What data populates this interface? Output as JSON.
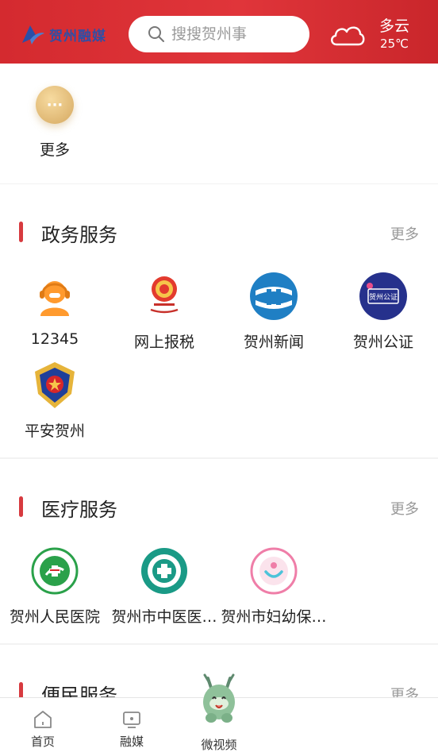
{
  "header": {
    "logo_text": "贺州融媒",
    "search_placeholder": "搜搜贺州事",
    "weather": {
      "condition": "多云",
      "temperature": "25℃"
    }
  },
  "top": {
    "more_label": "更多",
    "more_glyph": "···"
  },
  "gov": {
    "title": "政务服务",
    "more": "更多",
    "items": [
      {
        "label": "12345",
        "icon": "headset-agent-icon"
      },
      {
        "label": "网上报税",
        "icon": "tax-emblem-icon"
      },
      {
        "label": "贺州新闻",
        "icon": "hezhou-news-icon"
      },
      {
        "label": "贺州公证",
        "icon": "notary-icon",
        "badge": "贺州公证"
      },
      {
        "label": "平安贺州",
        "icon": "police-badge-icon"
      }
    ]
  },
  "med": {
    "title": "医疗服务",
    "more": "更多",
    "items": [
      {
        "label": "贺州人民医院",
        "icon": "people-hospital-icon"
      },
      {
        "label": "贺州市中医医…",
        "icon": "tcm-hospital-icon"
      },
      {
        "label": "贺州市妇幼保…",
        "icon": "maternal-child-icon"
      }
    ]
  },
  "conv": {
    "title": "便民服务",
    "more": "更多"
  },
  "tabs": [
    {
      "label": "首页",
      "icon": "home-icon"
    },
    {
      "label": "融媒",
      "icon": "media-screen-icon"
    },
    {
      "label": "微视频",
      "icon": "mascot-icon"
    }
  ],
  "colors": {
    "header_red": "#d42a2f",
    "accent_bar": "#d73a3f"
  }
}
